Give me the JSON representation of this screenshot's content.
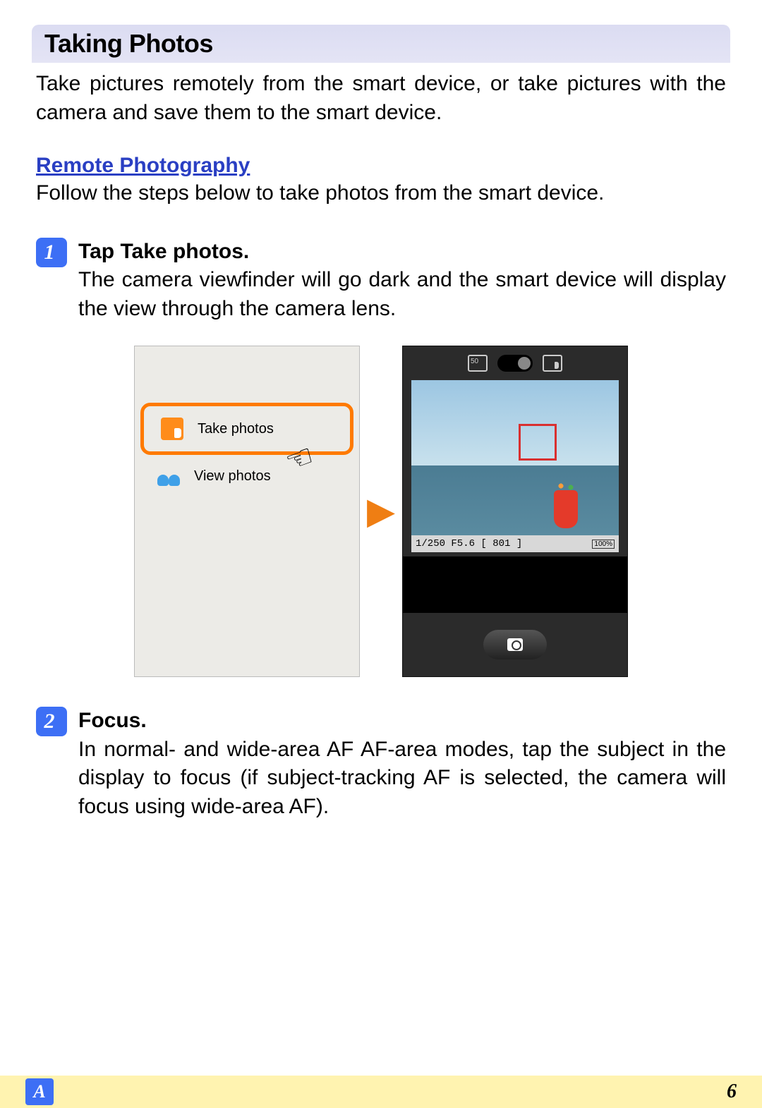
{
  "section": {
    "heading": "Taking Photos",
    "intro": "Take pictures remotely from the smart device, or take pictures with the camera and save them to the smart device."
  },
  "subsection": {
    "heading": "Remote Photography",
    "intro": "Follow the steps below to take photos from the smart device."
  },
  "steps": [
    {
      "num": "1",
      "title_prefix": "Tap ",
      "title_bold": "Take photos",
      "title_suffix": ".",
      "body": "The camera viewfinder will go dark and the smart device will display the view through the camera lens."
    },
    {
      "num": "2",
      "title_prefix": "",
      "title_bold": "Focus",
      "title_suffix": ".",
      "body": "In normal- and wide-area AF AF-area modes, tap the subject in the display to focus (if subject-tracking AF is selected, the camera will focus using wide-area AF)."
    }
  ],
  "phone_left": {
    "option1": "Take photos",
    "option2": "View photos"
  },
  "phone_right": {
    "shutter_info": "1/250  F5.6  [ 801 ]",
    "battery": "100%"
  },
  "footer": {
    "section_letter": "A",
    "page_number": "6"
  }
}
